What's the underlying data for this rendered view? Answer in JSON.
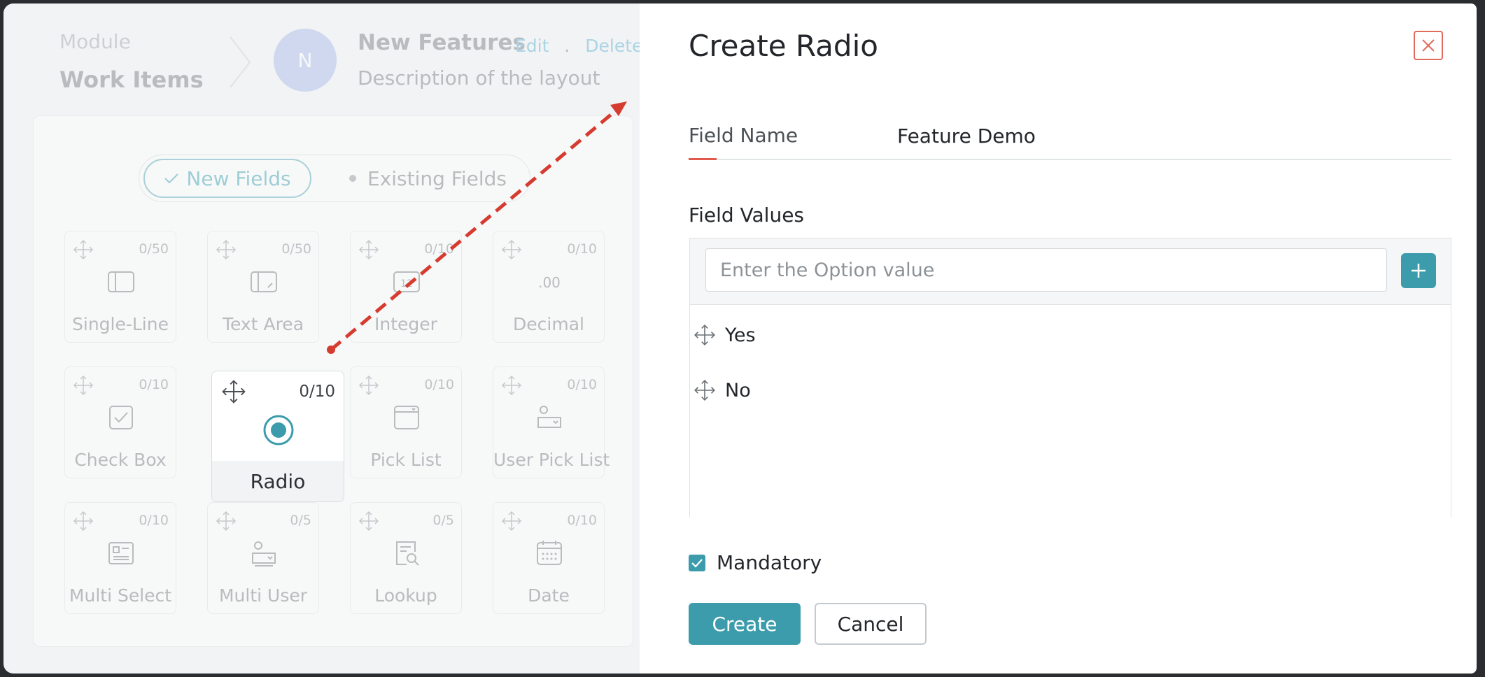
{
  "layout": {
    "module_label": "Module",
    "module_name": "Work Items",
    "avatar_initial": "N",
    "title": "New Features",
    "edit_link": "Edit",
    "separator": ".",
    "delete_link": "Delete",
    "separator2": ".",
    "description": "Description of the layout"
  },
  "toggle": {
    "new_fields": "New Fields",
    "existing_fields": "Existing Fields"
  },
  "field_types": [
    {
      "label": "Single-Line",
      "count": "0/50",
      "icon": "single-line-icon"
    },
    {
      "label": "Text Area",
      "count": "0/50",
      "icon": "text-area-icon"
    },
    {
      "label": "Integer",
      "count": "0/10",
      "icon": "integer-icon"
    },
    {
      "label": "Decimal",
      "count": "0/10",
      "icon": "decimal-icon"
    },
    {
      "label": "Check Box",
      "count": "0/10",
      "icon": "checkbox-icon"
    },
    {
      "label": "Radio",
      "count": "0/10",
      "icon": "radio-icon"
    },
    {
      "label": "Pick List",
      "count": "0/10",
      "icon": "pick-list-icon"
    },
    {
      "label": "User Pick List",
      "count": "0/10",
      "icon": "user-pick-list-icon"
    },
    {
      "label": "Multi Select",
      "count": "0/10",
      "icon": "multi-select-icon"
    },
    {
      "label": "Multi User",
      "count": "0/5",
      "icon": "multi-user-icon"
    },
    {
      "label": "Lookup",
      "count": "0/5",
      "icon": "lookup-icon"
    },
    {
      "label": "Date",
      "count": "0/10",
      "icon": "date-icon"
    }
  ],
  "decimal_glyph": ".00",
  "integer_glyph": "12",
  "dialog": {
    "title": "Create Radio",
    "field_name_label": "Field Name",
    "field_name_value": "Feature Demo",
    "field_values_label": "Field Values",
    "option_placeholder": "Enter the Option value",
    "options": [
      "Yes",
      "No"
    ],
    "mandatory_label": "Mandatory",
    "mandatory_checked": true,
    "create_label": "Create",
    "cancel_label": "Cancel"
  },
  "colors": {
    "accent": "#3c9cab",
    "close": "#e06b5c",
    "annotation_arrow": "#d63b2f"
  }
}
